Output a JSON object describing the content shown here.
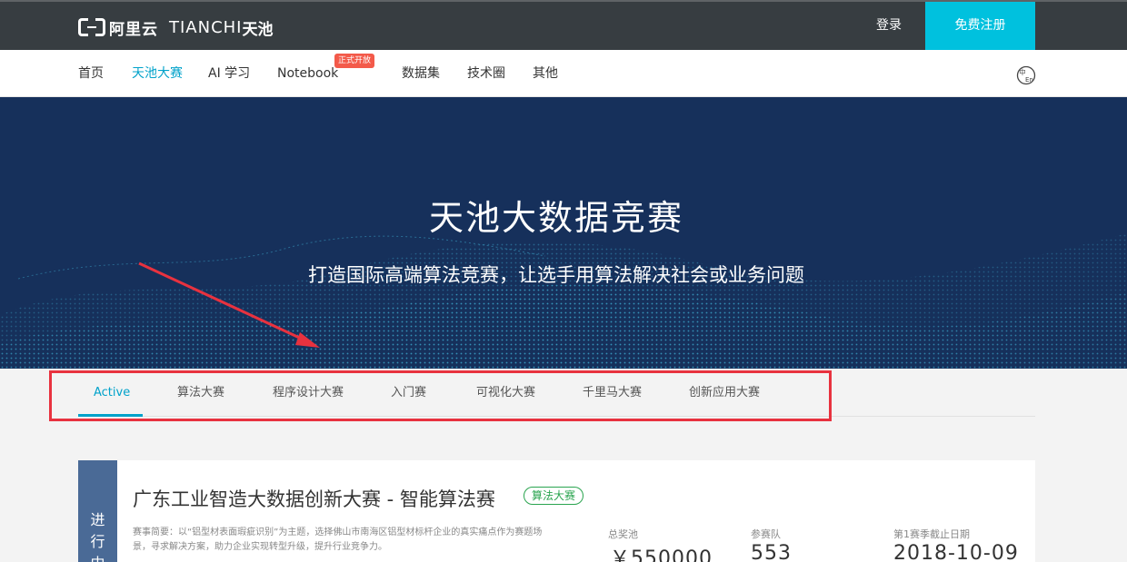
{
  "header": {
    "logo_aliyun": "阿里云",
    "logo_tianchi": "TIANCHI",
    "logo_tianchi_cn": "天池",
    "login": "登录",
    "register": "免费注册"
  },
  "nav": {
    "items": [
      "首页",
      "天池大赛",
      "AI 学习",
      "Notebook",
      "数据集",
      "技术圈",
      "其他"
    ],
    "badge": "正式开放",
    "lang_icon": "language-switch-icon"
  },
  "banner": {
    "title": "天池大数据竞赛",
    "subtitle": "打造国际高端算法竞赛，让选手用算法解决社会或业务问题"
  },
  "tabs": [
    "Active",
    "算法大赛",
    "程序设计大赛",
    "入门赛",
    "可视化大赛",
    "千里马大赛",
    "创新应用大赛"
  ],
  "competition": {
    "status": [
      "进",
      "行",
      "中"
    ],
    "title": "广东工业智造大数据创新大赛 - 智能算法赛",
    "tag": "算法大赛",
    "description": "赛事简要：以“铝型材表面瑕疵识别”为主题，选择佛山市南海区铝型材标杆企业的真实痛点作为赛题场景，寻求解决方案，助力企业实现转型升级，提升行业竞争力。",
    "prize_label": "总奖池",
    "prize_value": "￥550000",
    "teams_label": "参赛队",
    "teams_value": "553",
    "deadline_label": "第1赛季截止日期",
    "deadline_value": "2018-10-09"
  },
  "colors": {
    "topbar": "#373d41",
    "accent": "#00c1de",
    "active": "#00a2ca",
    "banner": "#16305b",
    "highlight_box": "#e8323f"
  }
}
